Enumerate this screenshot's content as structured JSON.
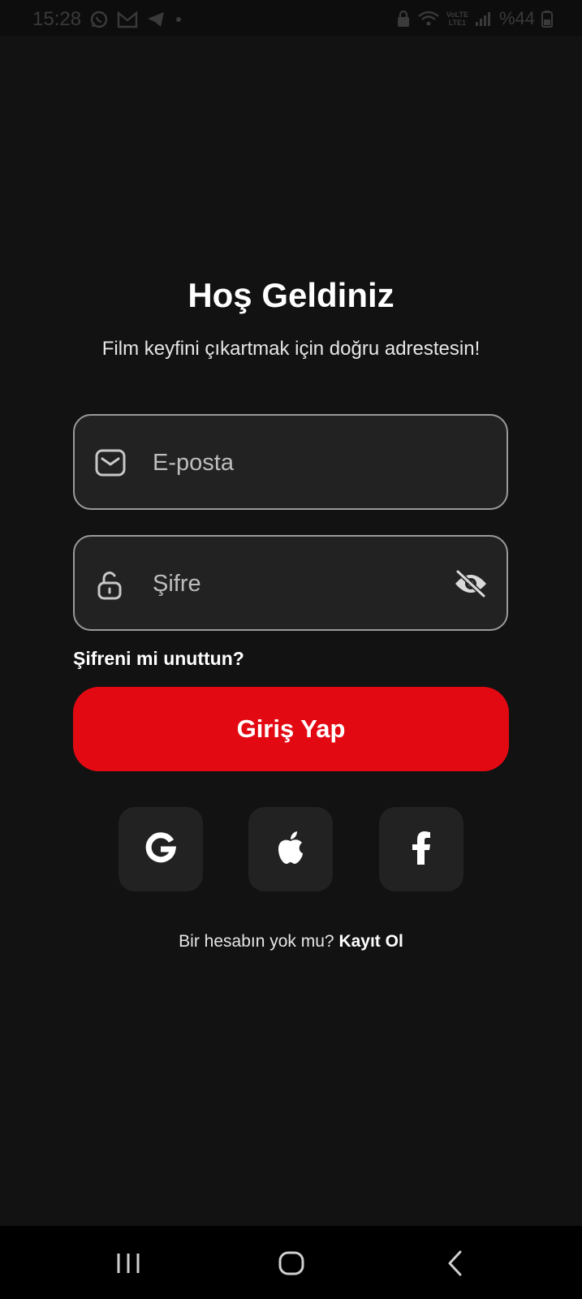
{
  "status_bar": {
    "time": "15:28",
    "network_label_top": "VoLTE",
    "network_label_bottom": "LTE1",
    "battery": "%44",
    "icons": [
      "whatsapp-icon",
      "gmail-icon",
      "telegram-icon",
      "dot-icon",
      "lock-icon",
      "wifi-icon",
      "signal-icon",
      "battery-icon"
    ]
  },
  "header": {
    "title": "Hoş Geldiniz",
    "subtitle": "Film keyfini çıkartmak için doğru adrestesin!"
  },
  "form": {
    "email": {
      "placeholder": "E-posta",
      "value": "",
      "icon": "mail-icon"
    },
    "password": {
      "placeholder": "Şifre",
      "value": "",
      "icon": "lock-open-icon",
      "toggle_icon": "eye-off-icon"
    },
    "forgot_label": "Şifreni mi unuttun?",
    "login_label": "Giriş Yap"
  },
  "social": [
    {
      "name": "google",
      "icon": "google-icon"
    },
    {
      "name": "apple",
      "icon": "apple-icon"
    },
    {
      "name": "facebook",
      "icon": "facebook-icon"
    }
  ],
  "signup": {
    "prompt": "Bir hesabın yok mu?",
    "link": "Kayıt Ol"
  },
  "nav_bar": {
    "icons": [
      "recent-apps-icon",
      "home-icon",
      "back-icon"
    ]
  },
  "colors": {
    "background": "#121212",
    "field_background": "#222222",
    "field_border": "#9a9a9a",
    "accent": "#e30913",
    "text": "#ffffff"
  }
}
